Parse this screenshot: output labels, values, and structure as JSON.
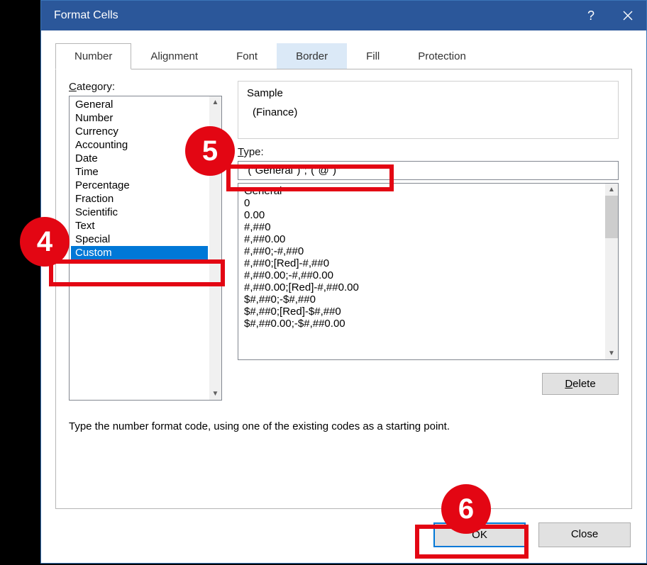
{
  "title": "Format Cells",
  "tabs": [
    "Number",
    "Alignment",
    "Font",
    "Border",
    "Fill",
    "Protection"
  ],
  "activeTab": 0,
  "hoverTab": 3,
  "labels": {
    "category": "Category:",
    "sample": "Sample",
    "type": "Type:",
    "delete": "Delete",
    "help": "Type the number format code, using one of the existing codes as a starting point.",
    "ok": "OK",
    "close": "Close"
  },
  "categories": [
    "General",
    "Number",
    "Currency",
    "Accounting",
    "Date",
    "Time",
    "Percentage",
    "Fraction",
    "Scientific",
    "Text",
    "Special",
    "Custom"
  ],
  "selectedCategory": 11,
  "sampleValue": "(Finance)",
  "typeValue": "\"(\"General\")\";\"(\"@\")\"",
  "formatList": [
    "General",
    "0",
    "0.00",
    "#,##0",
    "#,##0.00",
    "#,##0;-#,##0",
    "#,##0;[Red]-#,##0",
    "#,##0.00;-#,##0.00",
    "#,##0.00;[Red]-#,##0.00",
    "$#,##0;-$#,##0",
    "$#,##0;[Red]-$#,##0",
    "$#,##0.00;-$#,##0.00"
  ],
  "annotations": {
    "c4": "4",
    "c5": "5",
    "c6": "6"
  }
}
